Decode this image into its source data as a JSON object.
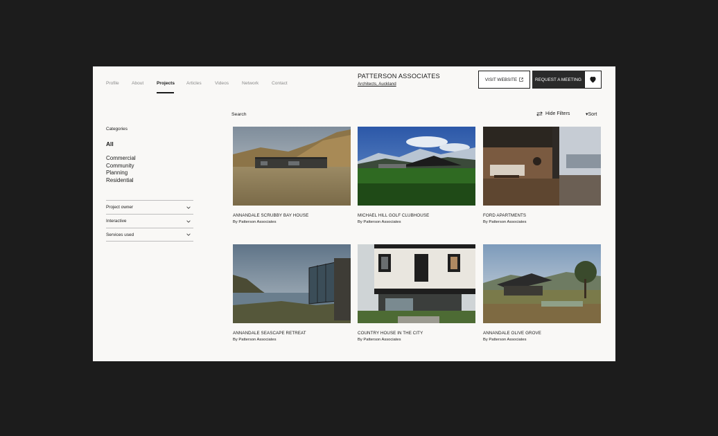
{
  "nav": {
    "items": [
      "Profile",
      "About",
      "Projects",
      "Articles",
      "Videos",
      "Network",
      "Contact"
    ],
    "active": "Projects"
  },
  "brand": {
    "name": "PATTERSON ASSOCIATES",
    "subtitle": "Architects, Auckland"
  },
  "actions": {
    "visit_label": "VISIT WEBSITE",
    "meeting_label": "REQUEST A MEETING"
  },
  "sidebar": {
    "categories_title": "Categories",
    "all_label": "All",
    "categories": [
      "Commercial",
      "Community",
      "Planning",
      "Residential"
    ],
    "filters": [
      "Project owner",
      "Interactive",
      "Services used"
    ]
  },
  "toolbar": {
    "search_label": "Search",
    "hide_filters_label": "Hide Filters",
    "sort_label": "▾Sort"
  },
  "projects": [
    {
      "title": "ANNANDALE SCRUBBY BAY HOUSE",
      "by": "By Patterson Associates"
    },
    {
      "title": "MICHAEL HILL GOLF CLUBHOUSE",
      "by": "By Patterson Associates"
    },
    {
      "title": "FORD APARTMENTS",
      "by": "By Patterson Associates"
    },
    {
      "title": "ANNANDALE SEASCAPE RETREAT",
      "by": "By Patterson Associates"
    },
    {
      "title": "COUNTRY HOUSE IN THE CITY",
      "by": "By Patterson Associates"
    },
    {
      "title": "ANNANDALE OLIVE GROVE",
      "by": "By Patterson Associates"
    }
  ],
  "colors": {
    "background": "#1c1c1c",
    "page": "#f9f8f6",
    "primary_button": "#2a2a2a",
    "text": "#1a1a1a",
    "muted": "#8a8a8a"
  }
}
